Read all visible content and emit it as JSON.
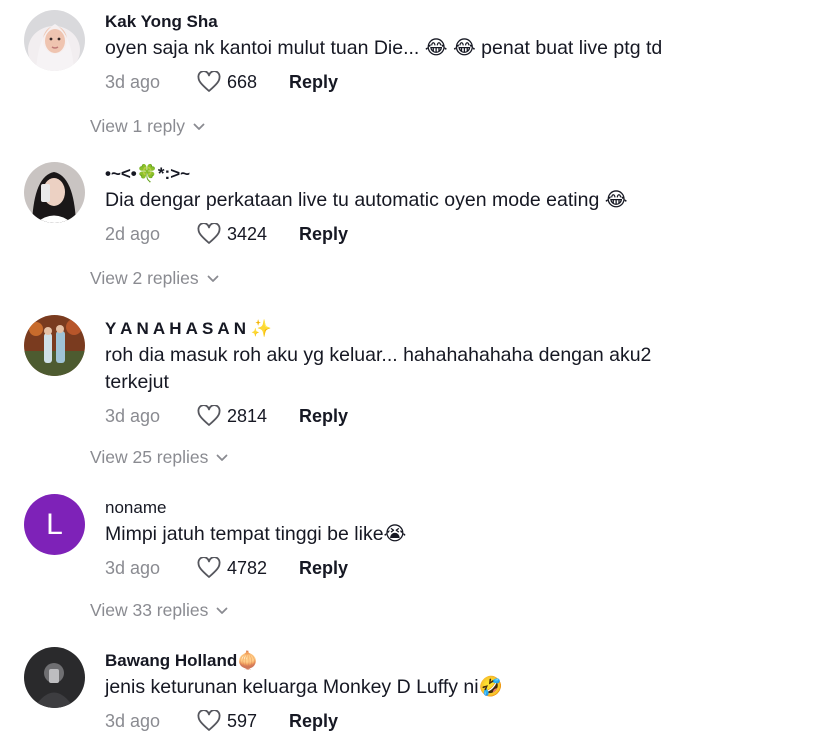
{
  "comments": [
    {
      "username": "Kak Yong Sha",
      "username_emoji": "",
      "text": "oyen saja nk kantoi mulut tuan Die... 😂 😂  penat buat live ptg td",
      "date": "3d ago",
      "likes": "668",
      "reply_label": "Reply",
      "replies_label": "View 1 reply"
    },
    {
      "username": "•~<•🍀*:>~",
      "username_emoji": "",
      "text": "Dia dengar perkataan live tu automatic oyen mode eating 😂",
      "date": "2d ago",
      "likes": "3424",
      "reply_label": "Reply",
      "replies_label": "View 2 replies"
    },
    {
      "username": "Y A N A H A S A N",
      "username_emoji": "✨",
      "text": "roh dia masuk roh aku yg keluar... hahahahahaha dengan aku2 terkejut",
      "date": "3d ago",
      "likes": "2814",
      "reply_label": "Reply",
      "replies_label": "View 25 replies"
    },
    {
      "username": "noname",
      "username_emoji": "",
      "avatar_letter": "L",
      "text": "Mimpi jatuh tempat tinggi be like😭",
      "date": "3d ago",
      "likes": "4782",
      "reply_label": "Reply",
      "replies_label": "View 33 replies"
    },
    {
      "username": "Bawang Holland",
      "username_emoji": "🧅",
      "text": "jenis keturunan keluarga Monkey D Luffy ni🤣",
      "date": "3d ago",
      "likes": "597",
      "reply_label": "Reply"
    }
  ],
  "colors": {
    "text": "#161823",
    "muted": "#8a8b91",
    "avatar_purple": "#7e22b8"
  },
  "icons": {
    "like": "heart-outline-icon",
    "expand": "chevron-down-icon"
  }
}
